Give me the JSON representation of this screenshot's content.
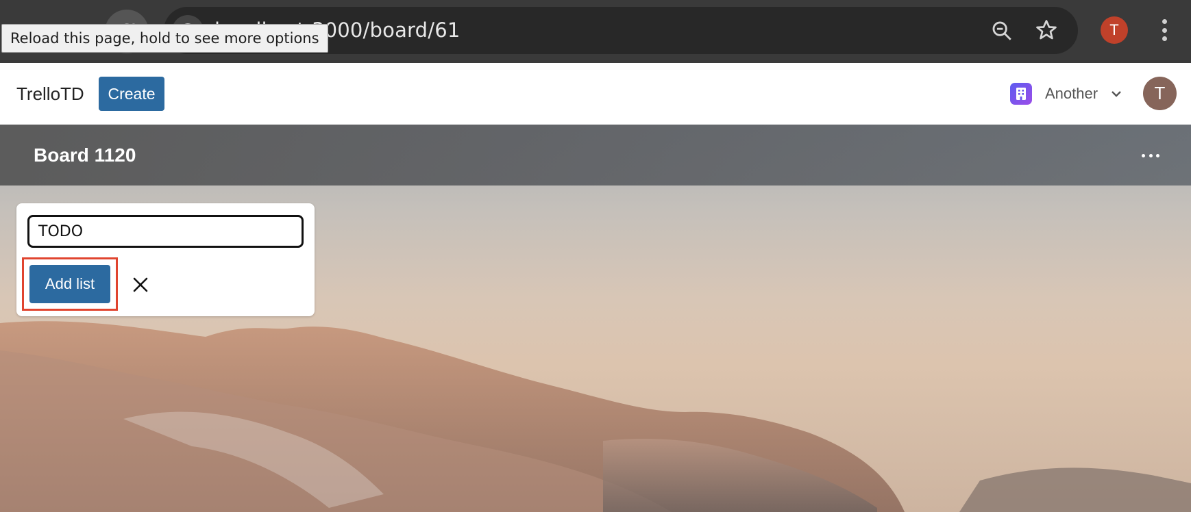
{
  "browser": {
    "url": "localhost:3000/board/61",
    "tooltip": "Reload this page, hold to see more options",
    "profile_initial": "T",
    "icons": [
      "back-icon",
      "forward-icon",
      "reload-icon",
      "site-info-icon",
      "zoom-out-icon",
      "star-icon",
      "kebab-menu-icon"
    ]
  },
  "header": {
    "brand": "TrelloTD",
    "create_label": "Create",
    "workspace_name": "Another",
    "user_initial": "T"
  },
  "board": {
    "title": "Board 1120"
  },
  "add_list": {
    "input_value": "TODO",
    "submit_label": "Add list"
  },
  "colors": {
    "primary_button": "#2c6aa0",
    "highlight": "#e0442f",
    "avatar": "#86655a",
    "profile_chip": "#c0412a"
  }
}
